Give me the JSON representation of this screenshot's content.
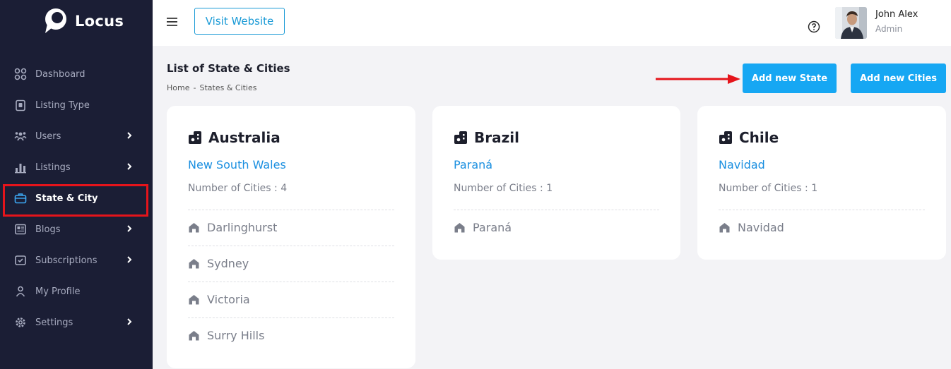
{
  "app": {
    "name": "Locus"
  },
  "sidebar": {
    "items": [
      {
        "label": "Dashboard",
        "icon": "grid-icon",
        "has_children": false,
        "active": false
      },
      {
        "label": "Listing Type",
        "icon": "clipboard-icon",
        "has_children": false,
        "active": false
      },
      {
        "label": "Users",
        "icon": "users-icon",
        "has_children": true,
        "active": false
      },
      {
        "label": "Listings",
        "icon": "bar-chart-icon",
        "has_children": true,
        "active": false
      },
      {
        "label": "State & City",
        "icon": "briefcase-icon",
        "has_children": false,
        "active": true
      },
      {
        "label": "Blogs",
        "icon": "newspaper-icon",
        "has_children": true,
        "active": false
      },
      {
        "label": "Subscriptions",
        "icon": "ticket-icon",
        "has_children": true,
        "active": false
      },
      {
        "label": "My Profile",
        "icon": "user-icon",
        "has_children": false,
        "active": false
      },
      {
        "label": "Settings",
        "icon": "gear-icon",
        "has_children": true,
        "active": false
      }
    ]
  },
  "topbar": {
    "visit_website": "Visit Website",
    "user": {
      "name": "John Alex",
      "role": "Admin"
    }
  },
  "page": {
    "title": "List of State & Cities",
    "breadcrumb": [
      "Home",
      "-",
      "States & Cities"
    ],
    "add_state": "Add new State",
    "add_cities": "Add new Cities"
  },
  "cards": [
    {
      "country": "Australia",
      "state": "New South Wales",
      "count_text": "Number of Cities : 4",
      "cities": [
        "Darlinghurst",
        "Sydney",
        "Victoria",
        "Surry Hills"
      ]
    },
    {
      "country": "Brazil",
      "state": "Paraná",
      "count_text": "Number of Cities : 1",
      "cities": [
        "Paraná"
      ]
    },
    {
      "country": "Chile",
      "state": "Navidad",
      "count_text": "Number of Cities : 1",
      "cities": [
        "Navidad"
      ]
    }
  ],
  "colors": {
    "sidebar_bg": "#1b1e35",
    "accent": "#16a7f3",
    "link": "#1a8fe0",
    "highlight": "#e5141b"
  }
}
